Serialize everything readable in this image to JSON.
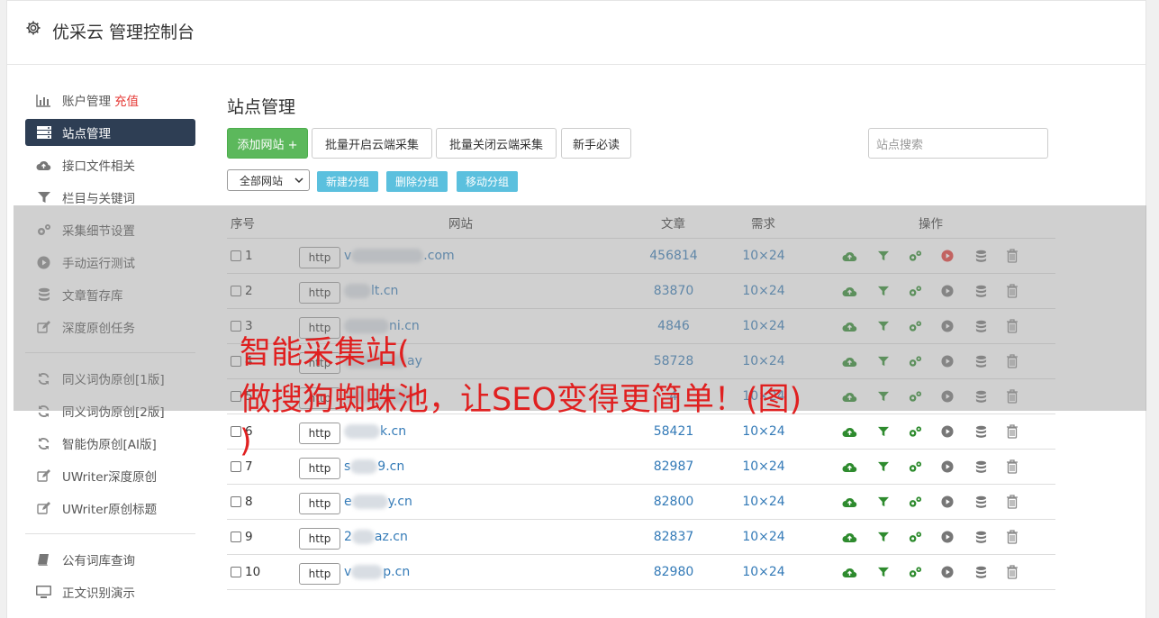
{
  "header": {
    "title": "优采云 管理控制台"
  },
  "sidebar": {
    "items": [
      {
        "label": "账户管理",
        "extra": "充值",
        "icon": "bar-chart-icon"
      },
      {
        "label": "站点管理",
        "icon": "server-icon",
        "active": true
      },
      {
        "label": "接口文件相关",
        "icon": "cloud-upload-icon"
      },
      {
        "label": "栏目与关键词",
        "icon": "filter-icon"
      },
      {
        "label": "采集细节设置",
        "icon": "gears-icon"
      },
      {
        "label": "手动运行测试",
        "icon": "play-circle-icon"
      },
      {
        "label": "文章暂存库",
        "icon": "database-icon"
      },
      {
        "label": "深度原创任务",
        "icon": "edit-icon"
      },
      {
        "label": "同义词伪原创[1版]",
        "icon": "refresh-icon"
      },
      {
        "label": "同义词伪原创[2版]",
        "icon": "refresh-icon"
      },
      {
        "label": "智能伪原创[AI版]",
        "icon": "refresh-icon"
      },
      {
        "label": "UWriter深度原创",
        "icon": "edit-icon"
      },
      {
        "label": "UWriter原创标题",
        "icon": "edit-icon"
      },
      {
        "label": "公有词库查询",
        "icon": "book-icon"
      },
      {
        "label": "正文识别演示",
        "icon": "monitor-icon"
      }
    ]
  },
  "main": {
    "title": "站点管理",
    "toolbar": {
      "add_site": "添加网站 +",
      "batch_enable": "批量开启云端采集",
      "batch_disable": "批量关闭云端采集",
      "beginner": "新手必读",
      "search_placeholder": "站点搜索"
    },
    "group_select": "全部网站",
    "group_buttons": {
      "new": "新建分组",
      "delete": "删除分组",
      "move": "移动分组"
    },
    "table": {
      "headers": {
        "index": "序号",
        "site": "网站",
        "articles": "文章",
        "demand": "需求",
        "actions": "操作"
      },
      "http_label": "http",
      "rows": [
        {
          "index": "1",
          "prefix": "v",
          "suffix": ".com",
          "articles": "456814",
          "demand": "10×24",
          "running": true
        },
        {
          "index": "2",
          "prefix": "",
          "suffix": "lt.cn",
          "articles": "83870",
          "demand": "10×24"
        },
        {
          "index": "3",
          "prefix": "",
          "suffix": "ni.cn",
          "articles": "4846",
          "demand": "10×24"
        },
        {
          "index": "4",
          "prefix": "",
          "suffix": "ay",
          "articles": "58728",
          "demand": "10×24"
        },
        {
          "index": "5",
          "prefix": "",
          "suffix": "",
          "articles": "4",
          "demand": "10×24"
        },
        {
          "index": "6",
          "prefix": "",
          "suffix": "k.cn",
          "articles": "58421",
          "demand": "10×24"
        },
        {
          "index": "7",
          "prefix": "s",
          "suffix": "9.cn",
          "articles": "82987",
          "demand": "10×24"
        },
        {
          "index": "8",
          "prefix": "e",
          "suffix": "y.cn",
          "articles": "82800",
          "demand": "10×24"
        },
        {
          "index": "9",
          "prefix": "2",
          "suffix": "az.cn",
          "articles": "82837",
          "demand": "10×24"
        },
        {
          "index": "10",
          "prefix": "v",
          "suffix": "p.cn",
          "articles": "82980",
          "demand": "10×24"
        }
      ]
    }
  },
  "overlay": {
    "line1": "智能采集站(",
    "line2": "做搜狗蜘蛛池，让SEO变得更简单！(图)",
    "line3": ")"
  },
  "colors": {
    "green": "#5cb85c",
    "sidebar_active": "#2e3e54",
    "link": "#337ab7",
    "info": "#5bc0de",
    "red": "#e02020"
  }
}
